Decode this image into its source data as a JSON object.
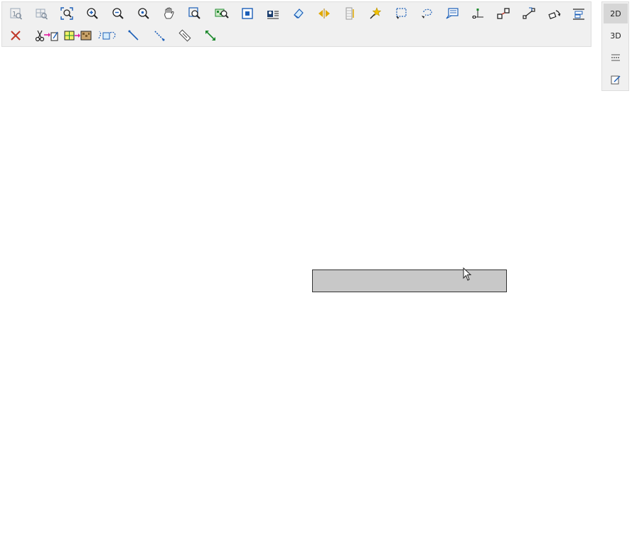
{
  "toolbar": {
    "row1": [
      {
        "name": "zoom-1-to-1-icon"
      },
      {
        "name": "zoom-previous-icon"
      },
      {
        "name": "zoom-extents-icon"
      },
      {
        "name": "zoom-in-icon"
      },
      {
        "name": "zoom-out-icon"
      },
      {
        "name": "zoom-dynamic-icon"
      },
      {
        "name": "pan-hand-icon"
      },
      {
        "name": "zoom-window-icon"
      },
      {
        "name": "zoom-layer-icon"
      },
      {
        "name": "select-object-icon"
      },
      {
        "name": "layer-properties-icon"
      },
      {
        "name": "erase-shape-icon"
      },
      {
        "name": "flip-horizontal-icon"
      },
      {
        "name": "column-grid-icon"
      },
      {
        "name": "highlight-star-icon"
      },
      {
        "name": "rect-selection-icon"
      },
      {
        "name": "lasso-selection-icon"
      },
      {
        "name": "callout-text-icon"
      },
      {
        "name": "node-insert-icon"
      },
      {
        "name": "node-move-icon"
      },
      {
        "name": "node-scale-icon"
      },
      {
        "name": "node-rotate-icon"
      },
      {
        "name": "node-align-icon"
      }
    ],
    "row2": [
      {
        "name": "delete-icon"
      },
      {
        "name": "cut-to-edit-icon"
      },
      {
        "name": "grid-to-raster-icon"
      },
      {
        "name": "shape-snap-icon"
      },
      {
        "name": "draw-line-icon"
      },
      {
        "name": "draw-dashed-line-icon"
      },
      {
        "name": "measure-ruler-icon"
      },
      {
        "name": "measure-distance-icon"
      }
    ]
  },
  "side_panel": {
    "view_2d_label": "2D",
    "view_3d_label": "3D",
    "active_view": "2D"
  },
  "colors": {
    "toolbar_bg": "#f0f0f0",
    "icon_blue": "#1c5fb8",
    "icon_dark": "#222222",
    "delete_red": "#c0392b",
    "measure_green": "#1e8a2e",
    "input_bg": "#c8c8c8"
  },
  "text_input": {
    "value": "",
    "placeholder": ""
  }
}
